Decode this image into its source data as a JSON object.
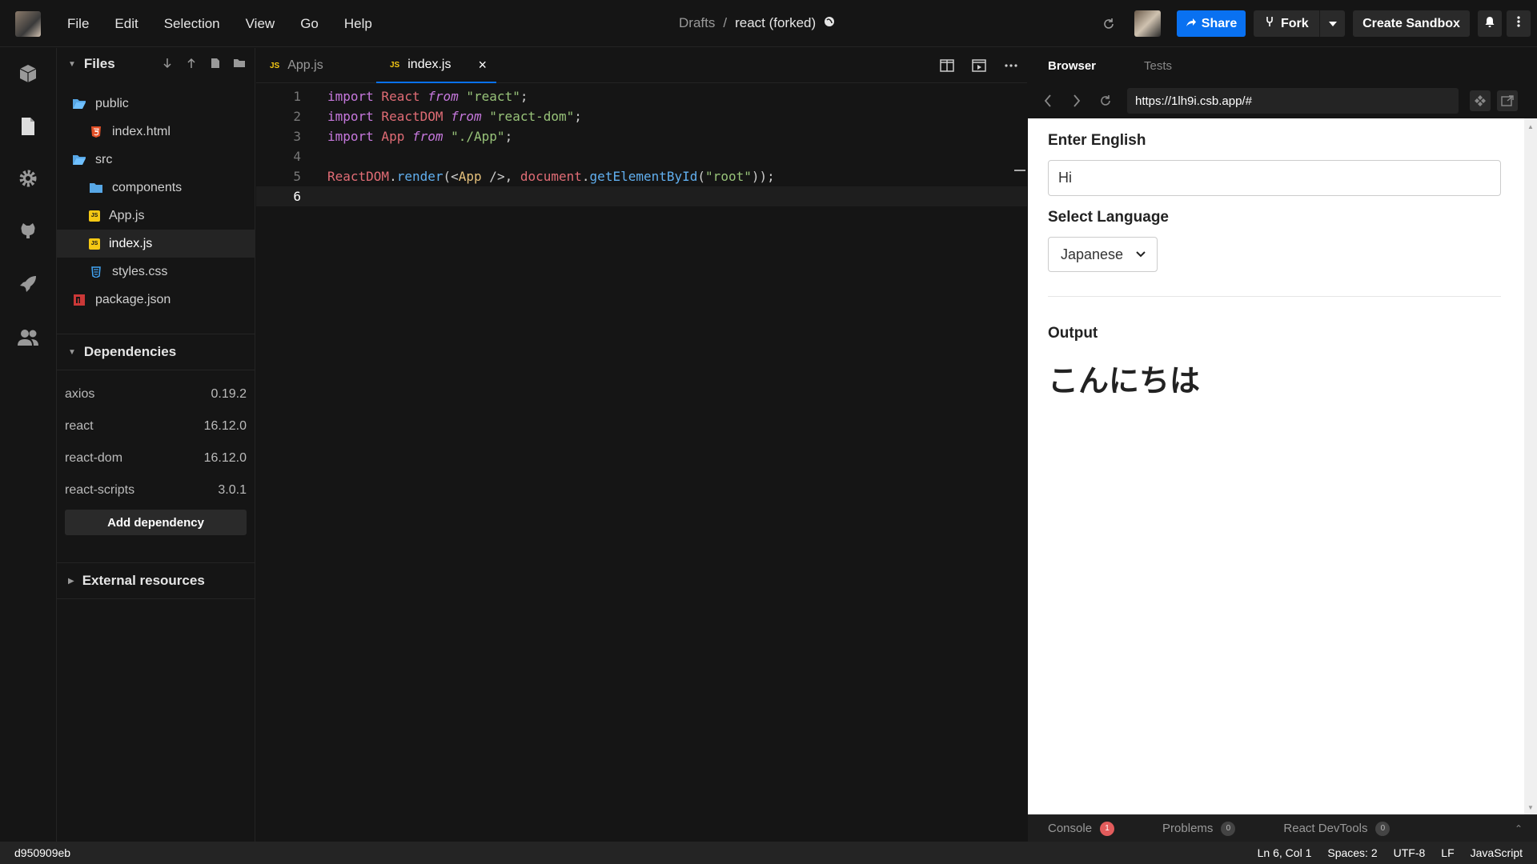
{
  "menu": [
    "File",
    "Edit",
    "Selection",
    "View",
    "Go",
    "Help"
  ],
  "breadcrumb": {
    "folder": "Drafts",
    "separator": "/",
    "sandbox": "react (forked)"
  },
  "toolbar": {
    "share": "Share",
    "fork": "Fork",
    "create": "Create Sandbox"
  },
  "files": {
    "title": "Files",
    "items": [
      {
        "label": "public",
        "type": "folder",
        "depth": 0
      },
      {
        "label": "index.html",
        "type": "html",
        "depth": 1
      },
      {
        "label": "src",
        "type": "folder",
        "depth": 0
      },
      {
        "label": "components",
        "type": "folder",
        "depth": 1
      },
      {
        "label": "App.js",
        "type": "js",
        "depth": 1
      },
      {
        "label": "index.js",
        "type": "js",
        "depth": 1
      },
      {
        "label": "styles.css",
        "type": "css",
        "depth": 1
      },
      {
        "label": "package.json",
        "type": "npm",
        "depth": 0
      }
    ]
  },
  "dependencies": {
    "title": "Dependencies",
    "items": [
      {
        "name": "axios",
        "version": "0.19.2"
      },
      {
        "name": "react",
        "version": "16.12.0"
      },
      {
        "name": "react-dom",
        "version": "16.12.0"
      },
      {
        "name": "react-scripts",
        "version": "3.0.1"
      }
    ],
    "add_label": "Add dependency"
  },
  "external": {
    "title": "External resources"
  },
  "tabs": [
    {
      "label": "App.js",
      "icon": "JS"
    },
    {
      "label": "index.js",
      "icon": "JS"
    }
  ],
  "code": {
    "line_numbers": [
      "1",
      "2",
      "3",
      "4",
      "5",
      "6"
    ],
    "l1": {
      "a": "import",
      "b": " React ",
      "c": "from",
      "d": " \"react\"",
      "e": ";"
    },
    "l2": {
      "a": "import",
      "b": " ReactDOM ",
      "c": "from",
      "d": " \"react-dom\"",
      "e": ";"
    },
    "l3": {
      "a": "import",
      "b": " App ",
      "c": "from",
      "d": " \"./App\"",
      "e": ";"
    },
    "l5": {
      "a": "ReactDOM",
      "b": ".",
      "c": "render",
      "d": "(<",
      "e": "App",
      "f": " />, ",
      "g": "document",
      "h": ".",
      "i": "getElementById",
      "j": "(",
      "k": "\"root\"",
      "l": "));"
    }
  },
  "preview": {
    "tabs": [
      "Browser",
      "Tests"
    ],
    "url": "https://1lh9i.csb.app/#",
    "enter_label": "Enter English",
    "input_value": "Hi",
    "select_label": "Select Language",
    "select_value": "Japanese",
    "output_label": "Output",
    "output_text": "こんにちは"
  },
  "console_tabs": [
    {
      "label": "Console",
      "count": "1"
    },
    {
      "label": "Problems",
      "count": "0"
    },
    {
      "label": "React DevTools",
      "count": "0"
    }
  ],
  "status": {
    "commit": "d950909eb",
    "position": "Ln 6, Col 1",
    "spaces": "Spaces: 2",
    "encoding": "UTF-8",
    "eol": "LF",
    "language": "JavaScript"
  },
  "colors": {
    "accent": "#0971f1",
    "badge_error": "#e25c5c",
    "js_icon": "#f5c814"
  }
}
